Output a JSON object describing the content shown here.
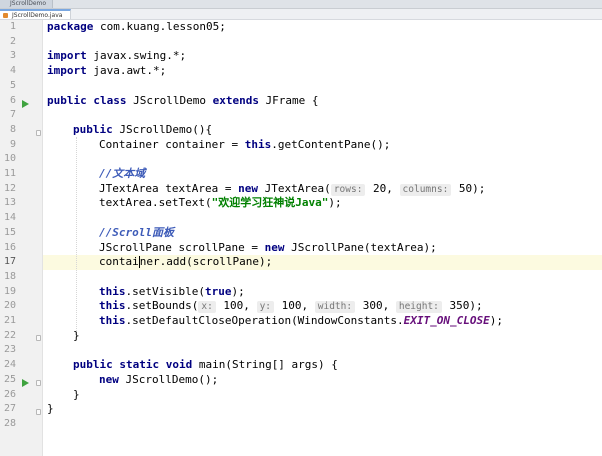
{
  "window": {
    "title": "JScrollDemo"
  },
  "tabs": [
    {
      "label": "JScrollDemo.java",
      "active": true
    }
  ],
  "editor": {
    "current_line": 17,
    "line_numbers": [
      "1",
      "2",
      "3",
      "4",
      "5",
      "6",
      "7",
      "8",
      "9",
      "10",
      "11",
      "12",
      "13",
      "14",
      "15",
      "16",
      "17",
      "18",
      "19",
      "20",
      "21",
      "22",
      "23",
      "24",
      "25",
      "26",
      "27",
      "28"
    ],
    "lines": {
      "l1": {
        "kw": "package",
        "rest": " com.kuang.lesson05;"
      },
      "l3": {
        "kw": "import",
        "rest": " javax.swing.*;"
      },
      "l4": {
        "kw": "import",
        "rest": " java.awt.*;"
      },
      "l6": {
        "kw1": "public class",
        "mid": " JScrollDemo ",
        "kw2": "extends",
        "rest": " JFrame {"
      },
      "l8": {
        "kw": "public",
        "rest": " JScrollDemo(){"
      },
      "l9": {
        "pre": "Container container = ",
        "kw": "this",
        "rest": ".getContentPane();"
      },
      "l11": {
        "comment": "//文本域"
      },
      "l12": {
        "pre": "JTextArea textArea = ",
        "kw": "new",
        "mid": " JTextArea(",
        "hint1": "rows:",
        "v1": " 20, ",
        "hint2": "columns:",
        "v2": " 50);"
      },
      "l13": {
        "pre": "textArea.setText(",
        "str": "\"欢迎学习狂神说Java\"",
        "rest": ");"
      },
      "l15": {
        "comment": "//Scroll面板"
      },
      "l16": {
        "pre": "JScrollPane scrollPane = ",
        "kw": "new",
        "rest": " JScrollPane(textArea);"
      },
      "l17": {
        "pre": "contai",
        "rest": "ner.add(scrollPane);"
      },
      "l19": {
        "kw": "this",
        "rest": ".setVisible(",
        "kw2": "true",
        "end": ");"
      },
      "l20": {
        "kw": "this",
        "mid": ".setBounds(",
        "hx": "x:",
        "vx": " 100, ",
        "hy": "y:",
        "vy": " 100, ",
        "hw": "width:",
        "vw": " 300, ",
        "hh": "height:",
        "vh": " 350);"
      },
      "l21": {
        "kw": "this",
        "mid": ".setDefaultCloseOperation(WindowConstants.",
        "const": "EXIT_ON_CLOSE",
        "end": ");"
      },
      "l22": {
        "rest": "}"
      },
      "l24": {
        "kw": "public static void",
        "rest": " main(String[] args) {"
      },
      "l25": {
        "kw": "new",
        "rest": " JScrollDemo();"
      },
      "l26": {
        "rest": "}"
      },
      "l27": {
        "rest": "}"
      }
    }
  },
  "icons": {
    "run": "run-gutter-icon",
    "fold": "fold-marker-icon"
  },
  "colors": {
    "keyword": "#000080",
    "comment": "#3d5bb8",
    "string": "#008000",
    "run": "#3fa33f",
    "current_line": "#fcfae0"
  }
}
